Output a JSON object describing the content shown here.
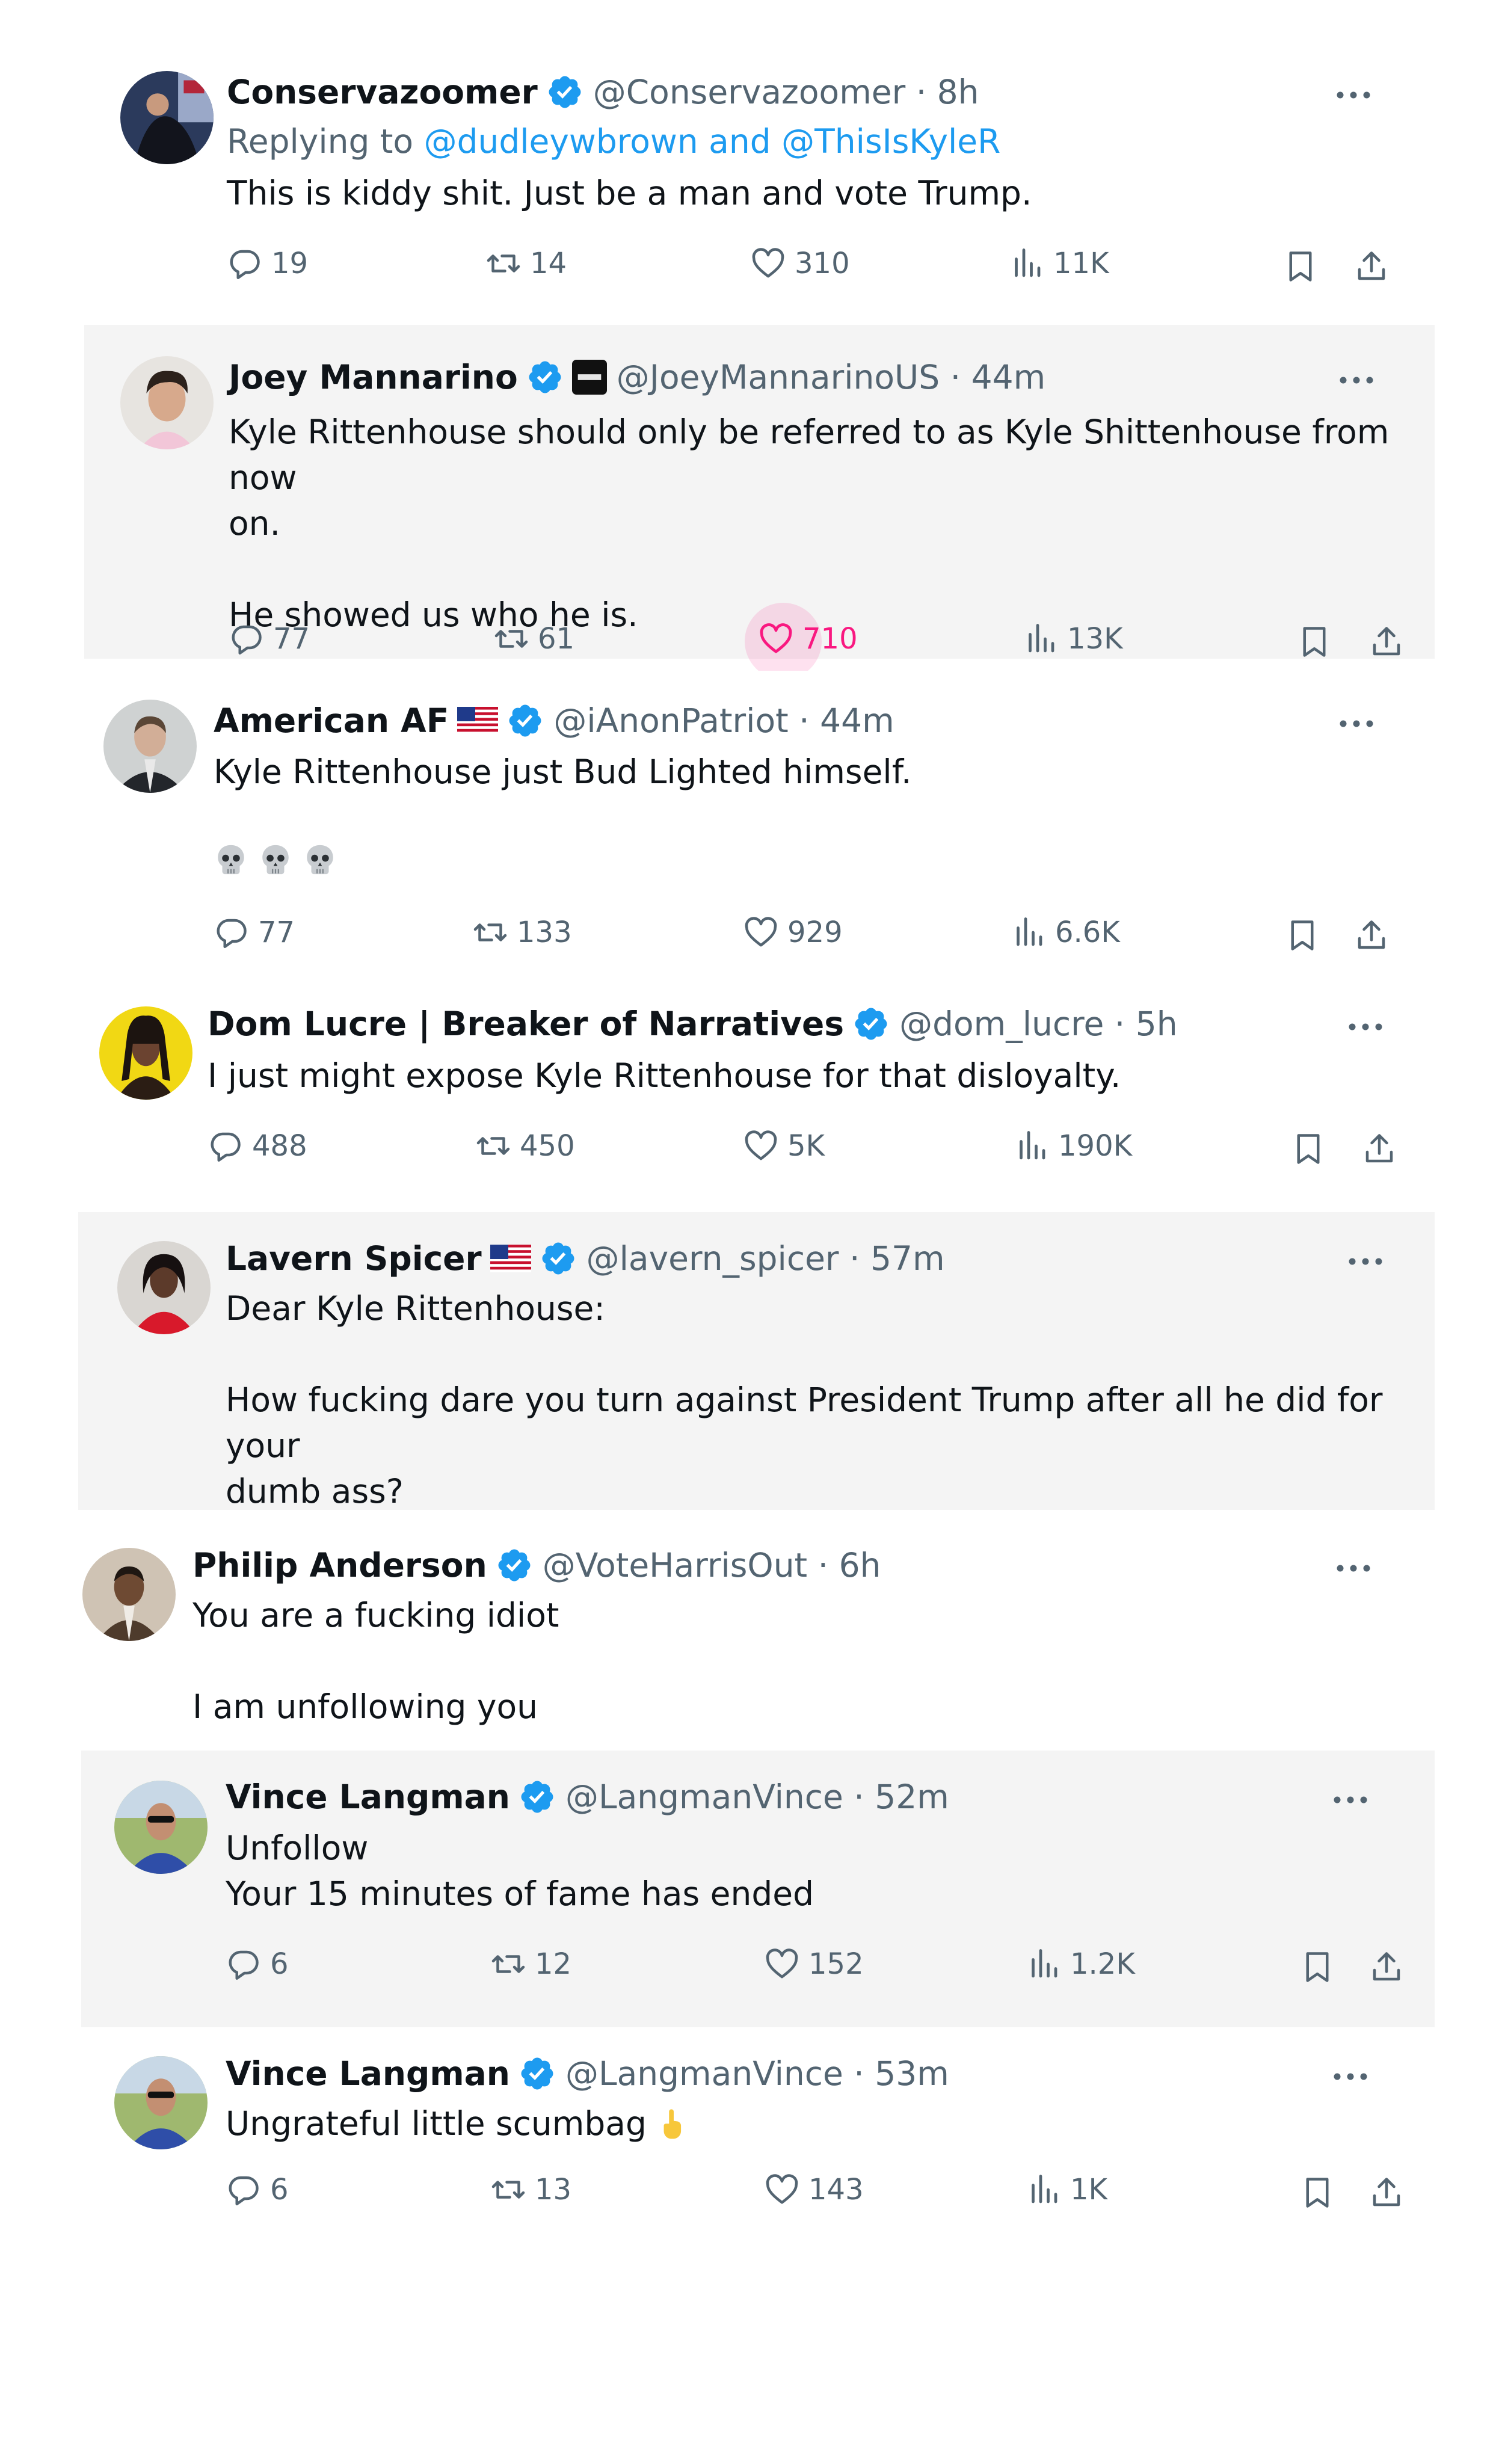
{
  "colors": {
    "accent": "#1d9bf0",
    "like": "#f91880",
    "muted": "#536471",
    "text": "#0f1419"
  },
  "posts": [
    {
      "name": "Conservazoomer",
      "handle": "@Conservazoomer · 8h",
      "reply_prefix": "Replying to ",
      "reply_to": "@dudleywbrown and @ThisIsKyleR",
      "lines": [
        "This is kiddy shit. Just be a man and vote Trump."
      ],
      "stats": {
        "replies": "19",
        "reposts": "14",
        "likes": "310",
        "views": "11K"
      }
    },
    {
      "name": "Joey Mannarino",
      "handle": "@JoeyMannarinoUS · 44m",
      "lines": [
        "Kyle Rittenhouse should only be referred to as Kyle Shittenhouse from now",
        "on.",
        "",
        "He showed us who he is."
      ],
      "stats": {
        "replies": "77",
        "reposts": "61",
        "likes": "710",
        "views": "13K"
      }
    },
    {
      "name": "American AF",
      "handle": "@iAnonPatriot · 44m",
      "lines": [
        "Kyle Rittenhouse just Bud Lighted himself."
      ],
      "emoji_icons": [
        "skull-icon",
        "skull-icon",
        "skull-icon"
      ],
      "stats": {
        "replies": "77",
        "reposts": "133",
        "likes": "929",
        "views": "6.6K"
      }
    },
    {
      "name": "Dom Lucre | Breaker of Narratives",
      "handle": "@dom_lucre · 5h",
      "lines": [
        "I just might expose Kyle Rittenhouse for that disloyalty."
      ],
      "stats": {
        "replies": "488",
        "reposts": "450",
        "likes": "5K",
        "views": "190K"
      }
    },
    {
      "name": "Lavern Spicer",
      "handle": "@lavern_spicer · 57m",
      "lines": [
        "Dear Kyle Rittenhouse:",
        "",
        "How fucking dare you turn against President Trump after all he did for your",
        "dumb ass?"
      ]
    },
    {
      "name": "Philip Anderson",
      "handle": "@VoteHarrisOut · 6h",
      "lines": [
        "You are a fucking idiot",
        "",
        "I am unfollowing you"
      ]
    },
    {
      "name": "Vince Langman",
      "handle": "@LangmanVince · 52m",
      "lines": [
        "Unfollow",
        "Your 15 minutes of fame has ended"
      ],
      "stats": {
        "replies": "6",
        "reposts": "12",
        "likes": "152",
        "views": "1.2K"
      }
    },
    {
      "name": "Vince Langman",
      "handle": "@LangmanVince · 53m",
      "lines": [
        "Ungrateful little scumbag"
      ],
      "trailing_emoji": "middle-finger-icon",
      "stats": {
        "replies": "6",
        "reposts": "13",
        "likes": "143",
        "views": "1K"
      }
    }
  ]
}
